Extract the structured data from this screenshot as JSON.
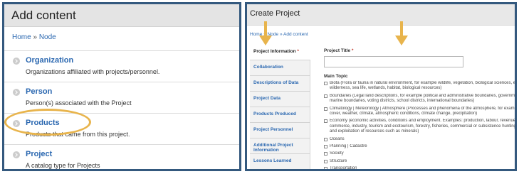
{
  "left_panel": {
    "title": "Add content",
    "breadcrumb": {
      "home": "Home",
      "separator": "»",
      "current": "Node"
    },
    "items": [
      {
        "title": "Organization",
        "description": "Organizations affiliated with projects/personnel."
      },
      {
        "title": "Person",
        "description": "Person(s) associated with the Project"
      },
      {
        "title": "Products",
        "description": "Products that came from this project."
      },
      {
        "title": "Project",
        "description": "A catalog type for Projects"
      }
    ],
    "highlight_color": "#e8b44c"
  },
  "right_panel": {
    "title": "Create Project",
    "breadcrumb": {
      "home": "Home",
      "separator": "»",
      "middle": "Node",
      "current": "Add content"
    },
    "tabs": [
      {
        "label": "Project Information",
        "required": "*"
      },
      {
        "label": "Collaboration"
      },
      {
        "label": "Descriptions of Data"
      },
      {
        "label": "Project Data"
      },
      {
        "label": "Products Produced"
      },
      {
        "label": "Project Personnel"
      },
      {
        "label": "Additional Project Information"
      },
      {
        "label": "Lessons Learned"
      }
    ],
    "form": {
      "project_title_label": "Project Title",
      "required_mark": "*",
      "project_title_value": "",
      "main_topic_label": "Main Topic",
      "topics": [
        {
          "lines": [
            "Biota (Flora or fauna in natural environment, for example wildlife, vegetation, biological sciences, ecology,",
            "wilderness, sea life, wetlands, habitat, biological resources)"
          ]
        },
        {
          "lines": [
            "Boundaries (Legal land descriptions, for example political and administrative boundaries, governmental un",
            "marine boundaries, voting districts, school districts, international boundaries)"
          ]
        },
        {
          "lines": [
            "Climatology | Meteorology | Atmosphere (Processes and phenomena of the atmosphere, for example cloud",
            "cover, weather, climate, atmospheric conditions, climate change, precipitation)"
          ]
        },
        {
          "lines": [
            "Economy (economic activities, conditions and employment. Examples: production, labour, revenue,",
            "commerce, industry, tourism and ecotourism, forestry, fisheries, commercial or subsistence hunting, explora",
            "and exploitation of resources such as minerals)"
          ]
        },
        {
          "lines": [
            "Oceans"
          ]
        },
        {
          "lines": [
            "Planning | Cadastre"
          ]
        },
        {
          "lines": [
            "Society"
          ]
        },
        {
          "lines": [
            "Structure"
          ]
        },
        {
          "lines": [
            "Transportation"
          ]
        }
      ]
    }
  },
  "arrow_color": "#e8b44c",
  "panel_border_color": "#34597e"
}
